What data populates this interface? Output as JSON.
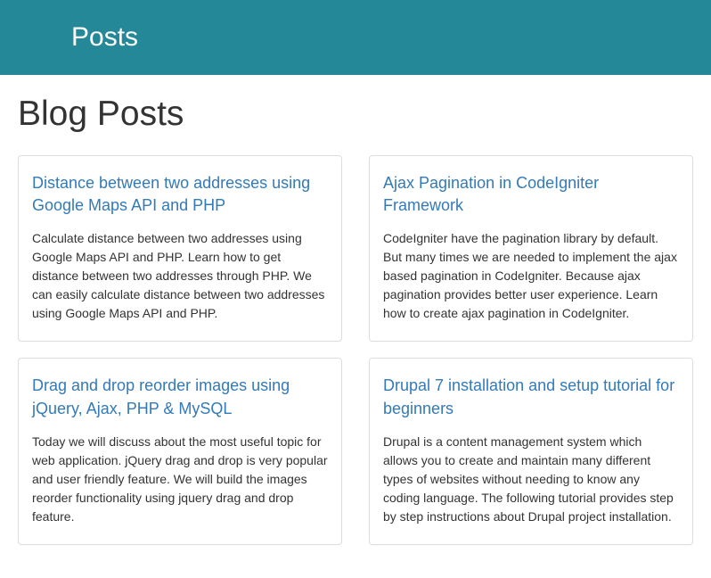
{
  "header": {
    "title": "Posts"
  },
  "page": {
    "heading": "Blog Posts"
  },
  "posts": [
    {
      "title": "Distance between two addresses using Google Maps API and PHP",
      "description": "Calculate distance between two addresses using Google Maps API and PHP. Learn how to get distance between two addresses through PHP. We can easily calculate distance between two addresses using Google Maps API and PHP."
    },
    {
      "title": "Ajax Pagination in CodeIgniter Framework",
      "description": "CodeIgniter have the pagination library by default. But many times we are needed to implement the ajax based pagination in CodeIgniter. Because ajax pagination provides better user experience. Learn how to create ajax pagination in CodeIgniter."
    },
    {
      "title": "Drag and drop reorder images using jQuery, Ajax, PHP & MySQL",
      "description": "Today we will discuss about the most useful topic for web application. jQuery drag and drop is very popular and user friendly feature. We will build the images reorder functionality using jquery drag and drop feature."
    },
    {
      "title": "Drupal 7 installation and setup tutorial for beginners",
      "description": "Drupal is a content management system which allows you to create and maintain many different types of websites without needing to know any coding language. The following tutorial provides step by step instructions about Drupal project installation."
    }
  ]
}
